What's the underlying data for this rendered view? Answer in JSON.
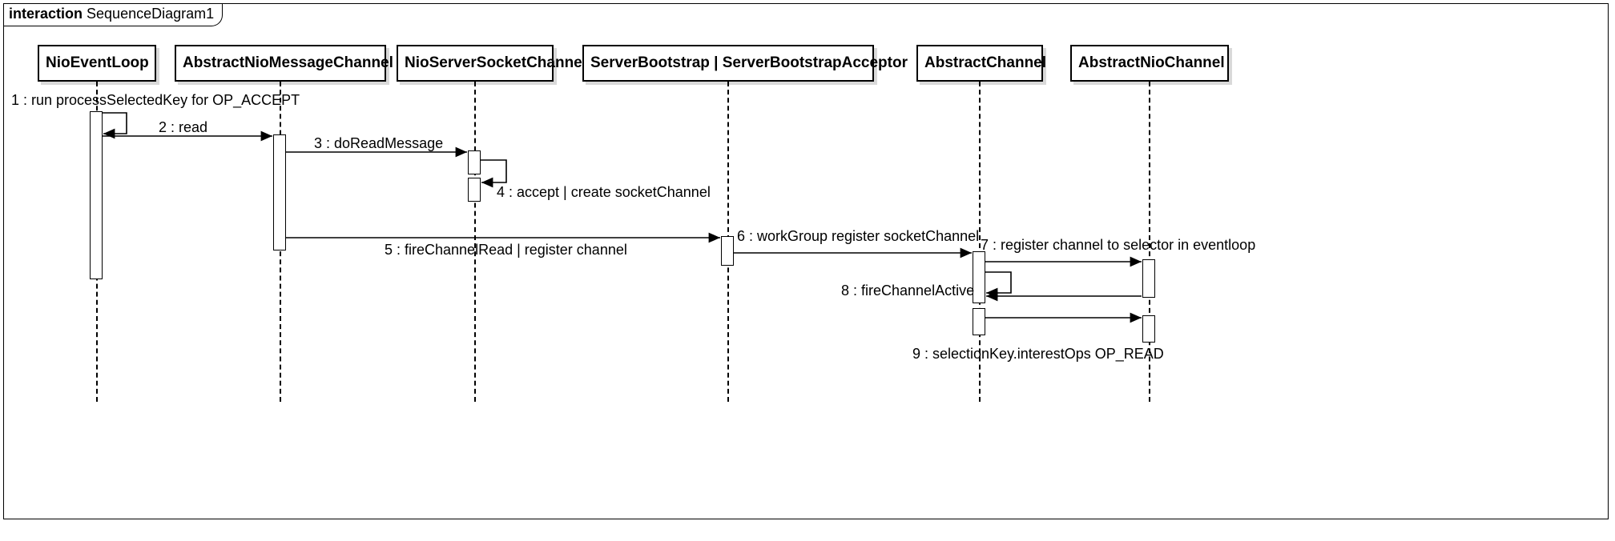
{
  "frame": {
    "keyword": "interaction",
    "name": "SequenceDiagram1"
  },
  "participants": {
    "p1": "NioEventLoop",
    "p2": "AbstractNioMessageChannel",
    "p3": "NioServerSocketChannel",
    "p4": "ServerBootstrap | ServerBootstrapAcceptor",
    "p5": "AbstractChannel",
    "p6": "AbstractNioChannel"
  },
  "messages": {
    "m1": "1 : run processSelectedKey for OP_ACCEPT",
    "m2": "2 : read",
    "m3": "3 : doReadMessage",
    "m4": "4 : accept | create socketChannel",
    "m5": "5 : fireChannelRead | register channel",
    "m6": "6 : workGroup register socketChannel",
    "m7": "7 : register channel to selector in eventloop",
    "m8": "8 : fireChannelActive",
    "m9": "9 : selectionKey.interestOps OP_READ"
  }
}
